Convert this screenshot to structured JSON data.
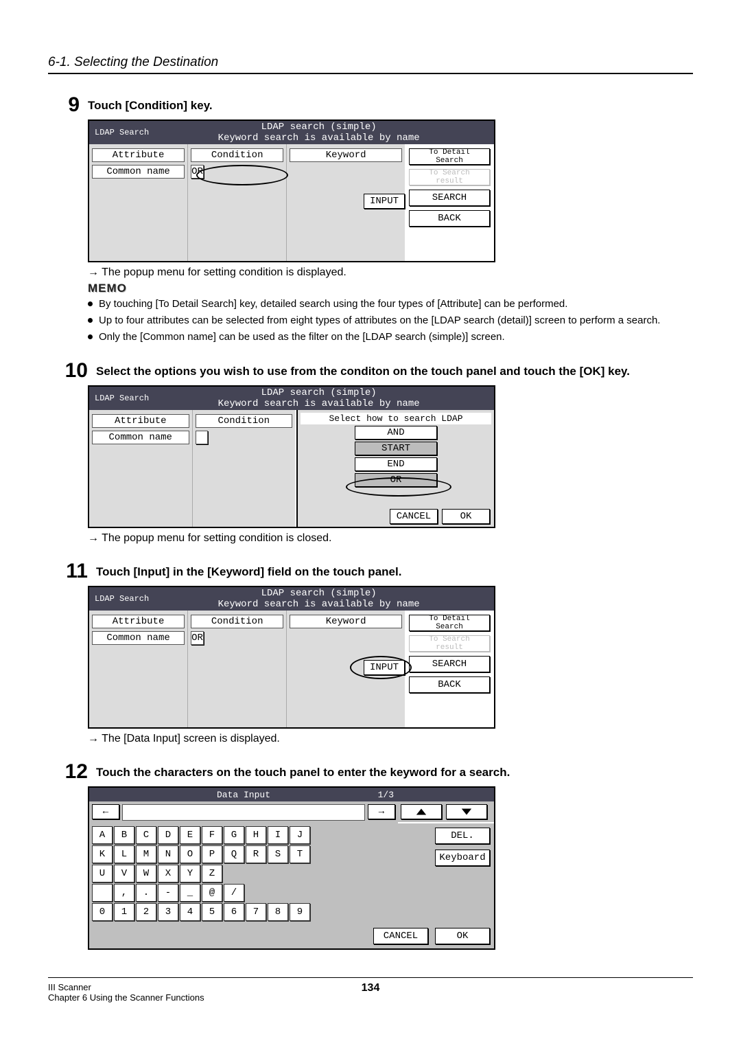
{
  "section_heading": "6-1. Selecting the Destination",
  "steps": {
    "s9": {
      "num": "9",
      "title": "Touch [Condition] key.",
      "arrow": "→ The popup menu for setting condition is displayed.",
      "memo_head": "MEMO",
      "memos": [
        "By touching [To Detail Search] key, detailed search using the four types of [Attribute] can be performed.",
        "Up to four attributes can be selected from eight types of attributes on the [LDAP search (detail)] screen to perform a search.",
        "Only the [Common name] can be used as the filter on the [LDAP search (simple)] screen."
      ]
    },
    "s10": {
      "num": "10",
      "title": "Select the options you wish to use from the conditon on the touch panel and touch the [OK] key.",
      "arrow": "→ The popup menu for setting condition is closed."
    },
    "s11": {
      "num": "11",
      "title": "Touch [Input] in the [Keyword] field on the touch panel.",
      "arrow": "→ The [Data Input] screen is displayed."
    },
    "s12": {
      "num": "12",
      "title": "Touch the characters on the touch panel to enter the keyword for a search."
    }
  },
  "panel": {
    "screen_title": "LDAP Search",
    "header_line1": "LDAP search (simple)",
    "header_line2": "Keyword search is available by name",
    "col_attr": "Attribute",
    "col_cond": "Condition",
    "col_keyword": "Keyword",
    "common_name": "Common name",
    "or": "OR",
    "input": "INPUT",
    "to_detail": "To Detail Search",
    "to_result": "To Search result",
    "search": "SEARCH",
    "back": "BACK"
  },
  "popup": {
    "title": "Select how to search LDAP",
    "and": "AND",
    "start": "START",
    "end": "END",
    "or": "OR",
    "cancel": "CANCEL",
    "ok": "OK"
  },
  "kbd": {
    "title": "Data Input",
    "page": "1/3",
    "arrow_left": "←",
    "arrow_right": "→",
    "rows": [
      [
        "A",
        "B",
        "C",
        "D",
        "E",
        "F",
        "G",
        "H",
        "I",
        "J"
      ],
      [
        "K",
        "L",
        "M",
        "N",
        "O",
        "P",
        "Q",
        "R",
        "S",
        "T"
      ],
      [
        "U",
        "V",
        "W",
        "X",
        "Y",
        "Z"
      ],
      [
        " ",
        ",",
        ".",
        "-",
        "_",
        "@",
        "/"
      ],
      [
        "0",
        "1",
        "2",
        "3",
        "4",
        "5",
        "6",
        "7",
        "8",
        "9"
      ]
    ],
    "del": "DEL.",
    "keyboard": "Keyboard",
    "cancel": "CANCEL",
    "ok": "OK"
  },
  "footer": {
    "left1": "III Scanner",
    "left2": "Chapter 6 Using the Scanner Functions",
    "page": "134"
  }
}
